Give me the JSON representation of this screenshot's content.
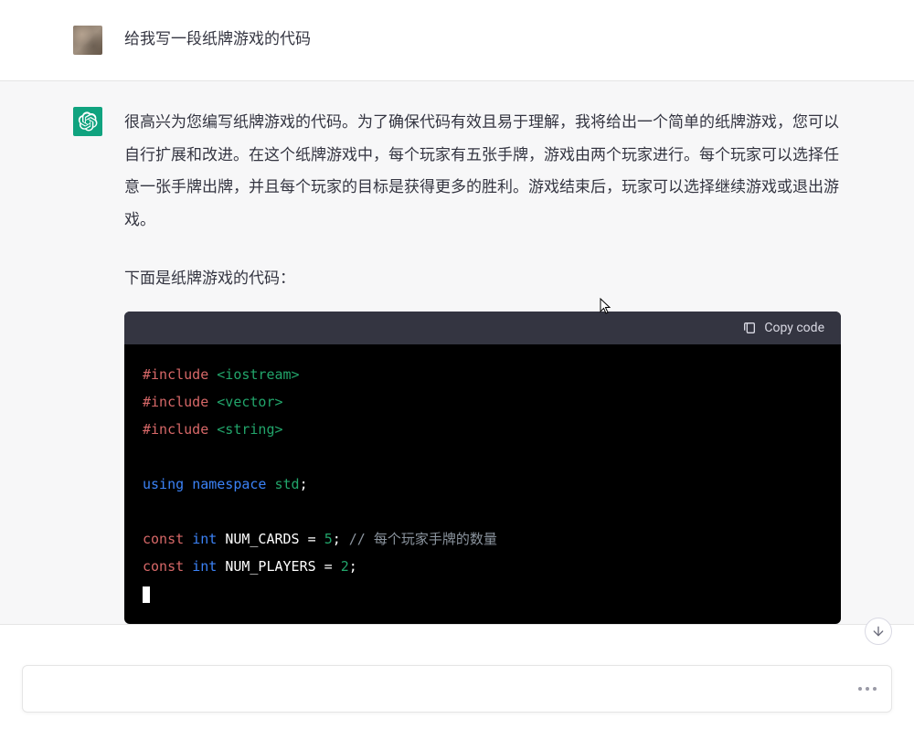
{
  "user": {
    "message": "给我写一段纸牌游戏的代码"
  },
  "assistant": {
    "paragraph1": "很高兴为您编写纸牌游戏的代码。为了确保代码有效且易于理解，我将给出一个简单的纸牌游戏，您可以自行扩展和改进。在这个纸牌游戏中，每个玩家有五张手牌，游戏由两个玩家进行。每个玩家可以选择任意一张手牌出牌，并且每个玩家的目标是获得更多的胜利。游戏结束后，玩家可以选择继续游戏或退出游戏。",
    "paragraph2": "下面是纸牌游戏的代码：",
    "copy_label": "Copy code",
    "code": {
      "line1_pre": "#",
      "line1_kw": "include",
      "line1_arg": "<iostream>",
      "line2_pre": "#",
      "line2_kw": "include",
      "line2_arg": "<vector>",
      "line3_pre": "#",
      "line3_kw": "include",
      "line3_arg": "<string>",
      "line5_kw1": "using",
      "line5_kw2": "namespace",
      "line5_id": "std",
      "line7_kw1": "const",
      "line7_kw2": "int",
      "line7_id": "NUM_CARDS",
      "line7_eq": " = ",
      "line7_val": "5",
      "line7_semi": ";",
      "line7_cmt": " // 每个玩家手牌的数量",
      "line8_kw1": "const",
      "line8_kw2": "int",
      "line8_id": "NUM_PLAYERS",
      "line8_eq": " = ",
      "line8_val": "2",
      "line8_semi": ";"
    }
  },
  "input": {
    "placeholder": ""
  }
}
